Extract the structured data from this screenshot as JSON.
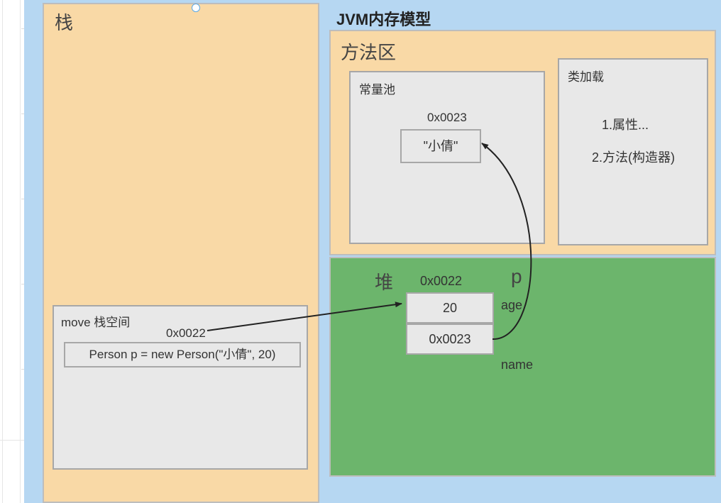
{
  "title": "JVM内存模型",
  "stack": {
    "title": "栈",
    "frame": {
      "title": "move 栈空间",
      "addr": "0x0022",
      "code": "Person p = new Person(\"小倩\", 20)"
    }
  },
  "method_area": {
    "title": "方法区",
    "const_pool": {
      "title": "常量池",
      "addr": "0x0023",
      "value": "\"小倩\""
    },
    "class_load": {
      "title": "类加载",
      "line1": "1.属性...",
      "line2": "2.方法(构造器)"
    }
  },
  "heap": {
    "title": "堆",
    "addr": "0x0022",
    "var": "p",
    "object": {
      "age_value": "20",
      "age_label": "age",
      "name_value": "0x0023",
      "name_label": "name"
    }
  }
}
